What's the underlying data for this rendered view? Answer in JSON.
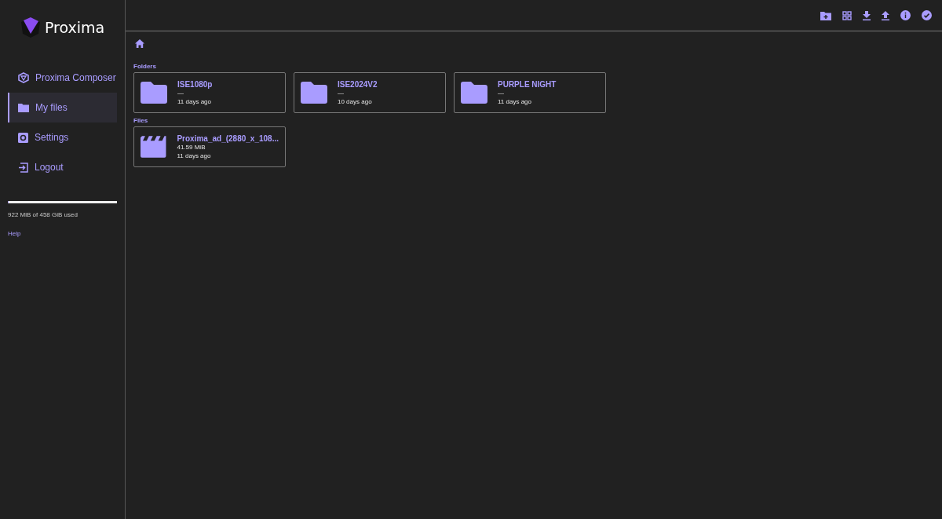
{
  "brand": {
    "name": "Proxima"
  },
  "sidebar": {
    "items": [
      {
        "label": "Proxima Composer",
        "selected": false
      },
      {
        "label": "My files",
        "selected": true
      },
      {
        "label": "Settings",
        "selected": false
      },
      {
        "label": "Logout",
        "selected": false
      }
    ],
    "storage": {
      "level": 0.002,
      "text": "922 MiB of 458 GiB used"
    },
    "help": "Help"
  },
  "sections": [
    {
      "title": "Folders",
      "items": [
        {
          "kind": "folder",
          "name": "ISE1080p",
          "size": "—",
          "modified": "11 days ago"
        },
        {
          "kind": "folder",
          "name": "ISE2024V2",
          "size": "—",
          "modified": "10 days ago"
        },
        {
          "kind": "folder",
          "name": "PURPLE NIGHT",
          "size": "—",
          "modified": "11 days ago"
        }
      ]
    },
    {
      "title": "Files",
      "items": [
        {
          "kind": "video",
          "name": "Proxima_ad_(2880_x_108...",
          "size": "41.59 MiB",
          "modified": "11 days ago"
        }
      ]
    }
  ]
}
